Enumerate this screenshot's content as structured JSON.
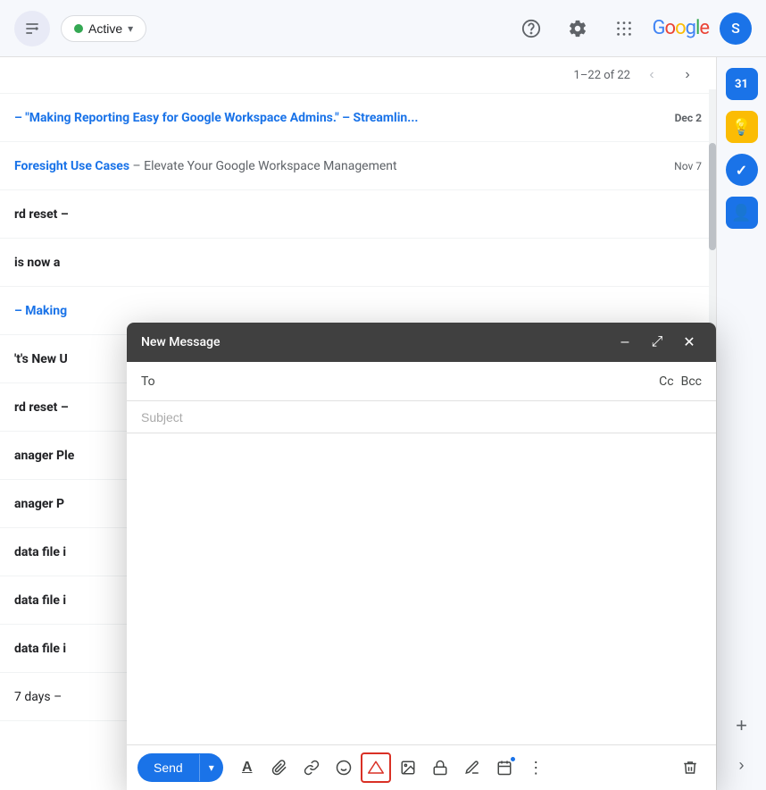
{
  "topbar": {
    "filter_icon": "≡",
    "active_label": "Active",
    "help_icon": "?",
    "settings_icon": "⚙",
    "apps_icon": "⋮⋮⋮",
    "avatar_letter": "S",
    "google_text": [
      "G",
      "o",
      "o",
      "g",
      "l",
      "e"
    ]
  },
  "pagination": {
    "range": "1–22 of 22",
    "prev_icon": "‹",
    "next_icon": "›"
  },
  "emails": [
    {
      "sender": "",
      "subject": "– \"Making Reporting Easy for Google Workspace Admins.\" – Streamlin...",
      "date": "Dec 2",
      "unread": true,
      "link": true
    },
    {
      "sender": "Foresight Use Cases",
      "subject": " – Elevate Your Google Workspace Management",
      "date": "Nov 7",
      "unread": false,
      "link": false
    },
    {
      "sender": "rd reset –",
      "subject": "",
      "date": "",
      "unread": false,
      "link": false
    },
    {
      "sender": "is now a",
      "subject": "",
      "date": "",
      "unread": false,
      "link": false
    },
    {
      "sender": "– Making",
      "subject": "",
      "date": "",
      "unread": false,
      "link": false
    },
    {
      "sender": "'t's New U",
      "subject": "",
      "date": "",
      "unread": false,
      "link": false
    },
    {
      "sender": "rd reset –",
      "subject": "",
      "date": "",
      "unread": false,
      "link": false
    },
    {
      "sender": "anager Ple",
      "subject": "",
      "date": "",
      "unread": false,
      "link": false
    },
    {
      "sender": "anager P",
      "subject": "",
      "date": "",
      "unread": false,
      "link": false
    },
    {
      "sender": "data file i",
      "subject": "",
      "date": "",
      "unread": false,
      "link": false
    },
    {
      "sender": "data file i",
      "subject": "",
      "date": "",
      "unread": false,
      "link": false
    },
    {
      "sender": "data file i",
      "subject": "",
      "date": "",
      "unread": false,
      "link": false
    },
    {
      "sender": "7 days –",
      "subject": "",
      "date": "",
      "unread": false,
      "link": false
    }
  ],
  "compose": {
    "title": "New Message",
    "minimize_icon": "–",
    "expand_icon": "⤢",
    "close_icon": "✕",
    "to_label": "To",
    "to_value": "",
    "cc_label": "Cc",
    "bcc_label": "Bcc",
    "subject_placeholder": "Subject",
    "body_text": "",
    "send_label": "Send",
    "send_dropdown": "▾"
  },
  "toolbar_icons": {
    "format_text": "A",
    "attach": "📎",
    "link": "🔗",
    "emoji": "☺",
    "drive": "▲",
    "photo": "🖼",
    "lock": "🔒",
    "pen": "✏",
    "calendar": "📅",
    "more": "⋮",
    "delete": "🗑"
  },
  "right_sidebar": {
    "calendar_icon": "31",
    "notes_icon": "📝",
    "tasks_icon": "✓",
    "contacts_icon": "👤",
    "plus_icon": "+",
    "arrow_icon": "›"
  },
  "colors": {
    "active_dot": "#34a853",
    "google_blue": "#4285F4",
    "google_red": "#EA4335",
    "google_yellow": "#FBBC04",
    "google_green": "#34A853",
    "compose_bg": "#404040",
    "send_btn": "#1a73e8",
    "highlight_border": "#d93025"
  }
}
